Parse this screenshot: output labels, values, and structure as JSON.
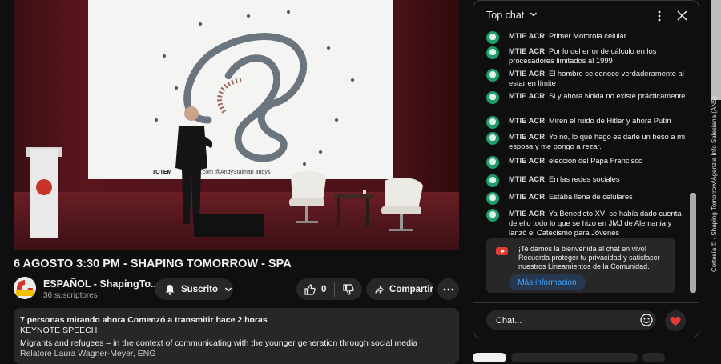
{
  "video": {
    "screen_brand": "TOTEM",
    "screen_credit": "zing.com   @AndyStalman   andys"
  },
  "watch": {
    "title": "6 AGOSTO 3:30 PM - SHAPING TOMORROW - SPA",
    "channel_name": "ESPAÑOL - ShapingTo...",
    "subscribers": "36 suscriptores",
    "subscribe_label": "Suscrito",
    "like_count": "0",
    "share_label": "Compartir"
  },
  "description": {
    "stats": "7 personas mirando ahora  Comenzó a transmitir hace 2 horas",
    "line1": "KEYNOTE SPEECH",
    "line2": "Migrants and refugees – in the context of communicating with the younger generation through social media",
    "line3": "Relatore Laura Wagner-Meyer, ENG"
  },
  "chat": {
    "header_title": "Top chat",
    "messages": [
      {
        "author": "MTIE ACR",
        "text": "Primer Motorola celular"
      },
      {
        "author": "MTIE ACR",
        "text": "Por lo del error de cálculo en los procesadores limitados al 1999"
      },
      {
        "author": "MTIE ACR",
        "text": "El hombre se conoce verdaderamente al estar en límite"
      },
      {
        "author": "MTIE ACR",
        "text": "Si y ahora Nokia no existe prácticamente"
      },
      {
        "author": "MTIE ACR",
        "text": "Miren el ruido de Hitler y ahora Putín"
      },
      {
        "author": "MTIE ACR",
        "text": "Yo no, lo que hago es darle un beso a mi esposa y me pongo a rezar."
      },
      {
        "author": "MTIE ACR",
        "text": "elección del Papa Francisco"
      },
      {
        "author": "MTIE ACR",
        "text": "En las redes sociales"
      },
      {
        "author": "MTIE ACR",
        "text": "Estaba llena de celulares"
      },
      {
        "author": "MTIE ACR",
        "text": "Ya Benedicto XVI se había dado cuenta de ello todo lo que se hizo en JMJ de Alemania y lanzó el Catecismo para Jóvenes"
      }
    ],
    "notice_text": "¡Te damos la bienvenida al chat en vivo! Recuerda proteger tu privacidad y satisfacer nuestros Lineamientos de la Comunidad.",
    "notice_button": "Más información",
    "input_placeholder": "Chat..."
  },
  "watermark": "Cortesía © - Shaping Tomorrow/Agenzia Info Salesiana (ANS)",
  "colors": {
    "background": "#0f0f0f",
    "surface": "#272727",
    "member_badge": "#1e9e68",
    "link_blue": "#3ea6ff",
    "youtube_red": "#e53935"
  }
}
